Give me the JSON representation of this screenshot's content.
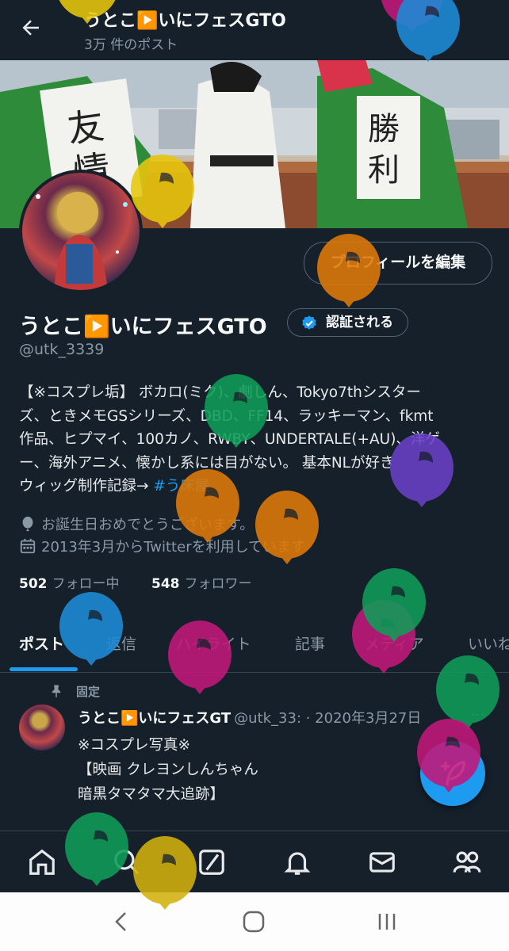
{
  "header": {
    "title": "うとこ▶️いにフェスGTO",
    "post_count": "3万 件のポスト"
  },
  "profile": {
    "edit_button": "プロフィールを編集",
    "name": "うとこ▶️いにフェスGTO",
    "verified_label": "認証される",
    "handle": "@utk_3339",
    "bio_lines": [
      "【※コスプレ垢】 ボカロ(ミク)、劇しん、Tokyo7thシスター",
      "ズ、ときメモGSシリーズ、DBD、FF14、ラッキーマン、fkmt",
      "作品、ヒプマイ、100カノ、RWBY、UNDERTALE(+AU)、洋ゲ",
      "ー、海外アニメ、懐かし系には目がない。 基本NLが好き"
    ],
    "bio_last_prefix": "ウィッグ制作記録→ ",
    "bio_hashtag": "#う床屋",
    "birthday": "お誕生日おめでとうございます。",
    "joined": "2013年3月からTwitterを利用しています",
    "following_count": "502",
    "following_label": "フォロー中",
    "followers_count": "548",
    "followers_label": "フォロワー"
  },
  "tabs": [
    "ポスト",
    "返信",
    "ハイライト",
    "記事",
    "メディア",
    "いいね"
  ],
  "pinned_post": {
    "pinned_label": "固定",
    "author": "うとこ▶️いにフェスGT",
    "handle_date": "@utk_33: · 2020年3月27日",
    "more": "···",
    "lines": [
      "※コスプレ写真※",
      "【映画 クレヨンしんちゃん",
      "暗黒タマタマ大追跡】"
    ]
  },
  "colors": {
    "background": "#15202b",
    "accent": "#1d9bf0",
    "muted": "#8b98a5",
    "balloons": [
      "#1d8cd8",
      "#c2187a",
      "#e8c70c",
      "#e07a0a",
      "#0f9d58",
      "#6a3fc8",
      "#d4b00e"
    ]
  },
  "icons": {
    "back": "arrow-left-icon",
    "verified": "verified-badge-icon",
    "birthday": "balloon-icon",
    "calendar": "calendar-icon",
    "pin": "pin-icon",
    "compose": "feather-plus-icon",
    "nav": [
      "home-icon",
      "search-icon",
      "grok-icon",
      "bell-icon",
      "mail-icon",
      "people-icon"
    ],
    "system": [
      "system-back-icon",
      "system-home-icon",
      "system-recents-icon"
    ]
  }
}
